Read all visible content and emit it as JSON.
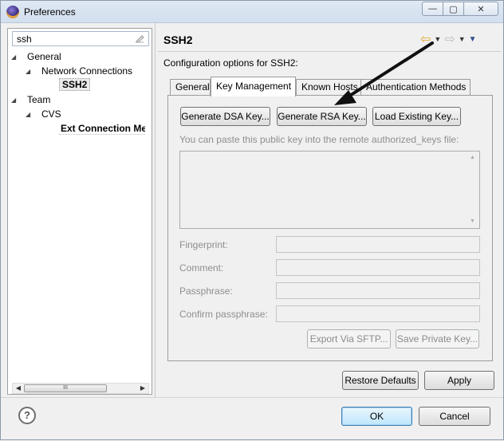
{
  "window": {
    "title": "Preferences",
    "minimize_glyph": "—",
    "maximize_glyph": "▢",
    "close_glyph": "✕"
  },
  "left": {
    "filter_value": "ssh",
    "tree": [
      {
        "label": "General"
      },
      {
        "label": "Network Connections"
      },
      {
        "label": "SSH2"
      },
      {
        "label": "Team"
      },
      {
        "label": "CVS"
      },
      {
        "label": "Ext Connection Me"
      }
    ],
    "scroll_thumb_glyph": "III"
  },
  "main": {
    "page_title": "SSH2",
    "config_label": "Configuration options for SSH2:",
    "tabs": [
      {
        "label": "General"
      },
      {
        "label": "Key Management"
      },
      {
        "label": "Known Hosts"
      },
      {
        "label": "Authentication Methods"
      }
    ],
    "active_tab": "Key Management",
    "buttons": {
      "generate_dsa": "Generate DSA Key...",
      "generate_rsa": "Generate RSA Key...",
      "load_existing": "Load Existing Key..."
    },
    "paste_hint": "You can paste this public key into the remote authorized_keys file:",
    "fields": {
      "fingerprint": "Fingerprint:",
      "comment": "Comment:",
      "passphrase": "Passphrase:",
      "confirm_passphrase": "Confirm passphrase:"
    },
    "export_button": "Export Via SFTP...",
    "save_private_button": "Save Private Key..."
  },
  "footer": {
    "restore_defaults": "Restore Defaults",
    "apply": "Apply",
    "ok": "OK",
    "cancel": "Cancel",
    "help_glyph": "?"
  },
  "colors": {
    "annotation_arrow": "#111111",
    "back_arrow": "#e4a62b"
  }
}
